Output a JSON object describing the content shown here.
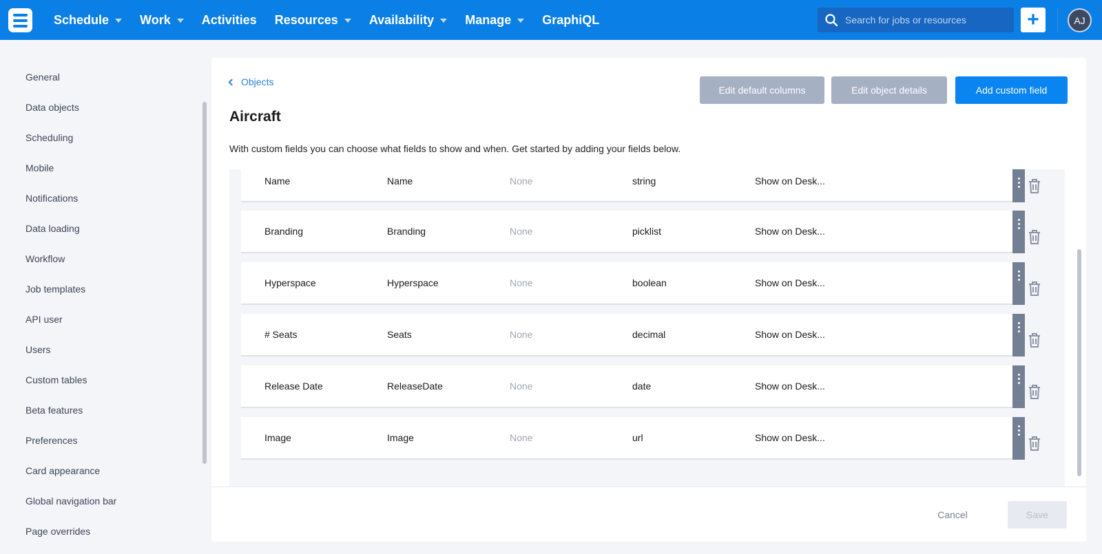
{
  "nav": {
    "items": [
      {
        "label": "Schedule",
        "dropdown": true
      },
      {
        "label": "Work",
        "dropdown": true
      },
      {
        "label": "Activities",
        "dropdown": false
      },
      {
        "label": "Resources",
        "dropdown": true
      },
      {
        "label": "Availability",
        "dropdown": true
      },
      {
        "label": "Manage",
        "dropdown": true
      },
      {
        "label": "GraphiQL",
        "dropdown": false
      }
    ],
    "search_placeholder": "Search for jobs or resources",
    "add_label": "+",
    "avatar_initials": "AJ",
    "colors": {
      "bar": "#0a7fe6",
      "search_bg": "#1666c2"
    }
  },
  "sidebar": {
    "items": [
      "General",
      "Data objects",
      "Scheduling",
      "Mobile",
      "Notifications",
      "Data loading",
      "Workflow",
      "Job templates",
      "API user",
      "Users",
      "Custom tables",
      "Beta features",
      "Preferences",
      "Card appearance",
      "Global navigation bar",
      "Page overrides"
    ]
  },
  "main": {
    "back_label": "Objects",
    "title": "Aircraft",
    "description": "With custom fields you can choose what fields to show and when. Get started by adding your fields below.",
    "buttons": {
      "edit_default_columns": "Edit default columns",
      "edit_object_details": "Edit object details",
      "add_custom_field": "Add custom field"
    },
    "fields": [
      {
        "label": "Name",
        "name": "Name",
        "default": "None",
        "type": "string",
        "visibility": "Show on Desk..."
      },
      {
        "label": "Branding",
        "name": "Branding",
        "default": "None",
        "type": "picklist",
        "visibility": "Show on Desk..."
      },
      {
        "label": "Hyperspace",
        "name": "Hyperspace",
        "default": "None",
        "type": "boolean",
        "visibility": "Show on Desk..."
      },
      {
        "label": "# Seats",
        "name": "Seats",
        "default": "None",
        "type": "decimal",
        "visibility": "Show on Desk..."
      },
      {
        "label": "Release Date",
        "name": "ReleaseDate",
        "default": "None",
        "type": "date",
        "visibility": "Show on Desk..."
      },
      {
        "label": "Image",
        "name": "Image",
        "default": "None",
        "type": "url",
        "visibility": "Show on Desk..."
      }
    ],
    "footer": {
      "cancel": "Cancel",
      "save": "Save"
    },
    "colors": {
      "primary": "#0a84f0",
      "secondary": "#a6b0c3",
      "menu_handle": "#737f93"
    }
  }
}
